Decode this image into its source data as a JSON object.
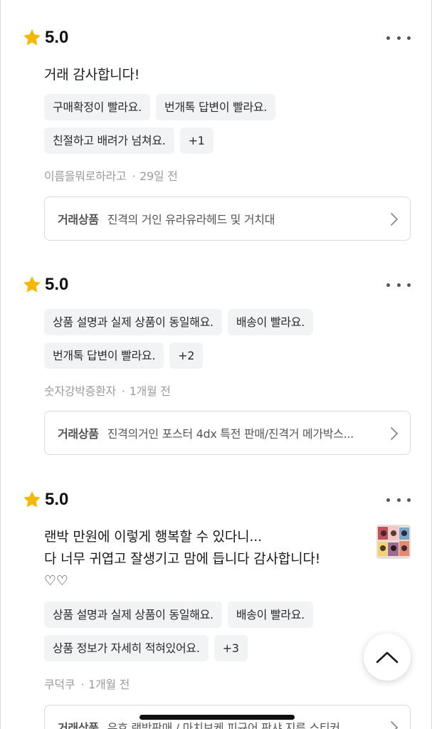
{
  "reviews": [
    {
      "score": "5.0",
      "text_lines": [
        "거래 감사합니다!"
      ],
      "tags": [
        "구매확정이 빨라요.",
        "번개톡 답변이 빨라요.",
        "친절하고 배려가 넘쳐요."
      ],
      "more_tags": "+1",
      "author": "이름을뭐로하라고",
      "time": "29일 전",
      "product_label": "거래상품",
      "product_name": "진격의 거인 유라유라헤드 및 거치대"
    },
    {
      "score": "5.0",
      "text_lines": [],
      "tags": [
        "상품 설명과 실제 상품이 동일해요.",
        "배송이 빨라요.",
        "번개톡 답변이 빨라요."
      ],
      "more_tags": "+2",
      "author": "숫자강박증환자",
      "time": "1개월 전",
      "product_label": "거래상품",
      "product_name": "진격의거인 포스터 4dx 특전 판매/진격거 메가박스..."
    },
    {
      "score": "5.0",
      "text_lines": [
        "랜박 만원에 이렇게 행복할 수 있다니...",
        "다 너무 귀엽고 잘생기고 맘에 듭니다 감사합니다!",
        "♡♡"
      ],
      "tags": [
        "상품 설명과 실제 상품이 동일해요.",
        "배송이 빨라요.",
        "상품 정보가 자세히 적혀있어요."
      ],
      "more_tags": "+3",
      "author": "쿠덕쿠",
      "time": "1개월 전",
      "product_label": "거래상품",
      "product_name": "유호 랜박판매 / 마치보케 피규어 판샤 지류 스티커"
    }
  ],
  "colors": {
    "star": "#f5b700",
    "chip_bg": "#f2f3f5",
    "meta_text": "#9a9ca1",
    "border": "#d9dadd"
  },
  "icons": {
    "star": "star-icon",
    "more": "more-options-icon",
    "chevron": "chevron-right-icon",
    "scroll_top": "chevron-up-icon"
  }
}
